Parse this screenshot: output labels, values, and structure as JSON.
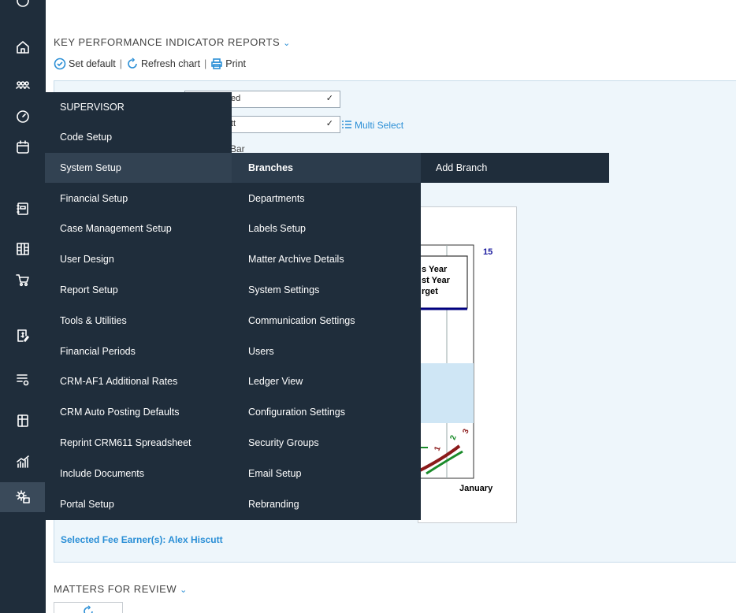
{
  "kpi": {
    "title": "KEY PERFORMANCE INDICATOR REPORTS",
    "chevron": "⌄",
    "set_default": "Set default",
    "refresh_chart": "Refresh chart",
    "print": "Print",
    "separator": "|"
  },
  "filters": {
    "select1_value": "ed",
    "select2_value": "tt",
    "multi_select": "Multi Select",
    "chart_type_label": "Bar"
  },
  "chart": {
    "top_value": "15",
    "legend": [
      "s Year",
      "st Year",
      "rget"
    ],
    "x_label": "January",
    "line_labels": [
      "1",
      "2",
      "3"
    ]
  },
  "selected_fee_earner": "Selected Fee Earner(s): Alex Hiscutt",
  "menu": {
    "column1": [
      "SUPERVISOR",
      "Code Setup",
      "System Setup",
      "Financial Setup",
      "Case Management Setup",
      "User Design",
      "Report Setup",
      "Tools & Utilities",
      "Financial Periods",
      "CRM-AF1 Additional Rates",
      "CRM Auto Posting Defaults",
      "Reprint CRM611 Spreadsheet",
      "Include Documents",
      "Portal Setup"
    ],
    "column2": [
      "Branches",
      "Departments",
      "Labels Setup",
      "Matter Archive Details",
      "System Settings",
      "Communication Settings",
      "Users",
      "Ledger View",
      "Configuration Settings",
      "Security Groups",
      "Email Setup",
      "Rebranding"
    ],
    "column3": [
      "Add Branch"
    ]
  },
  "matters_for_review": {
    "title": "MATTERS FOR REVIEW",
    "chevron": "⌄"
  },
  "rail_icons": [
    "home-icon",
    "users-icon",
    "dashboard-icon",
    "calendar-icon",
    "notebook-icon",
    "columns-icon",
    "cart-icon",
    "invoice-icon",
    "settings-list-icon",
    "documents-icon",
    "chart-icon",
    "gear-icon"
  ]
}
